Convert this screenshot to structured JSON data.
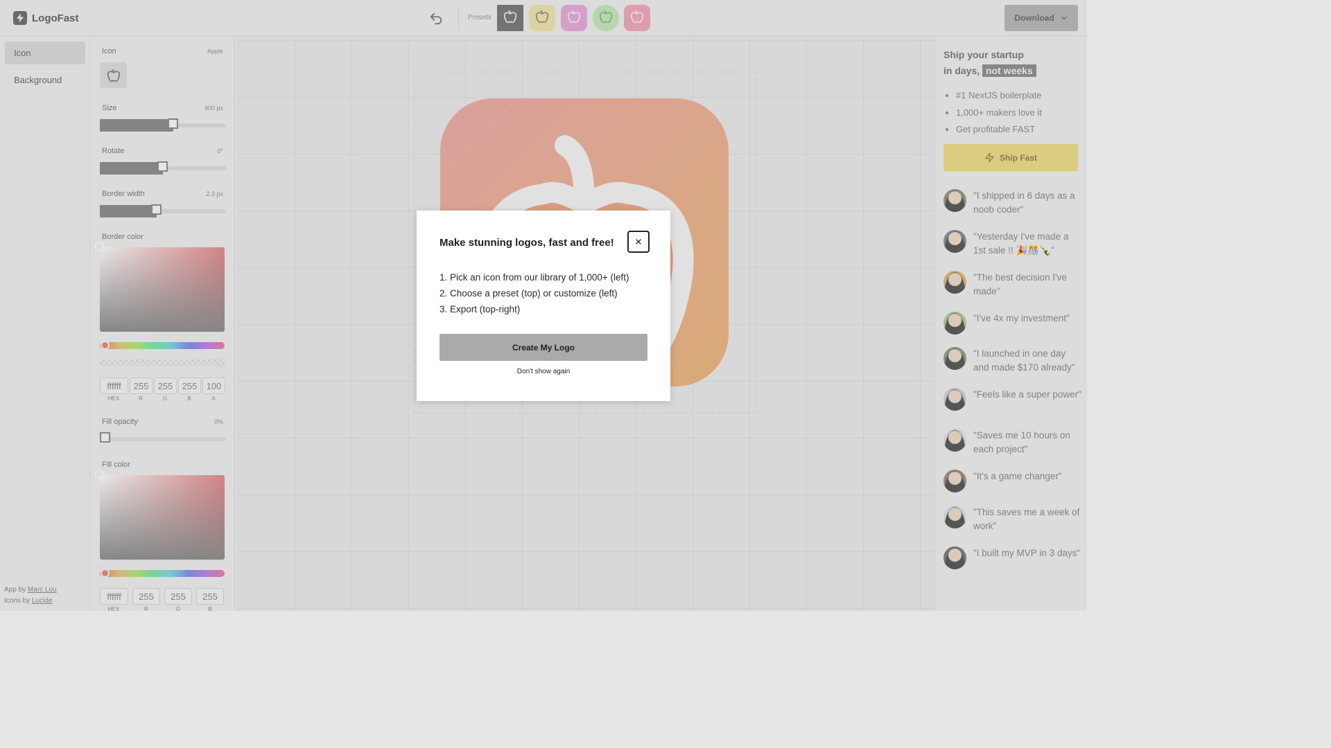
{
  "app": {
    "name": "LogoFast"
  },
  "header": {
    "presets_label": "Presets",
    "download_label": "Download",
    "presets": [
      {
        "name": "preset-dark",
        "bg": "#7a7a7a",
        "fg": "#efefef",
        "shape": "square"
      },
      {
        "name": "preset-yellow",
        "bg": "#e8dfae",
        "fg": "#8d8770",
        "shape": "rounded"
      },
      {
        "name": "preset-pink",
        "bg": "#e0a9d3",
        "fg": "#f2e8f0",
        "shape": "rounded"
      },
      {
        "name": "preset-green",
        "bg": "#bfe3b8",
        "fg": "#8fa98a",
        "shape": "circle"
      },
      {
        "name": "preset-rose",
        "bg": "#e8a6b8",
        "fg": "#f3e6ea",
        "shape": "rounded"
      }
    ]
  },
  "nav": {
    "items": [
      "Icon",
      "Background"
    ],
    "credits": {
      "app_by": "App by",
      "app_author": "Marc Lou",
      "icons_by": "Icons by",
      "icons_author": "Lucide"
    }
  },
  "panel": {
    "icon_label": "Icon",
    "icon_name": "Apple",
    "size": {
      "label": "Size",
      "value": "400 px",
      "level": 0.58
    },
    "rotate": {
      "label": "Rotate",
      "value": "0°",
      "level": 0.5
    },
    "border_width": {
      "label": "Border width",
      "value": "2.3 px",
      "level": 0.45
    },
    "border_color": {
      "label": "Border color",
      "hex": "ffffff",
      "r": "255",
      "g": "255",
      "b": "255",
      "a": "100",
      "caps": {
        "hex": "HEX",
        "r": "R",
        "g": "G",
        "b": "B",
        "a": "A"
      }
    },
    "fill_opacity": {
      "label": "Fill opacity",
      "value": "0%",
      "level": 0.0
    },
    "fill_color": {
      "label": "Fill color",
      "hex": "ffffff",
      "r": "255",
      "g": "255",
      "b": "255",
      "caps": {
        "hex": "HEX",
        "r": "R",
        "g": "G",
        "b": "B"
      }
    }
  },
  "canvas": {
    "logo_gradient": [
      "#e6a9a6",
      "#e6b47e"
    ],
    "icon": "apple-icon"
  },
  "modal": {
    "title": "Make stunning logos, fast and free!",
    "steps": [
      "1. Pick an icon from our library of 1,000+ (left)",
      "2. Choose a preset (top) or customize (left)",
      "3. Export (top-right)"
    ],
    "primary_label": "Create My Logo",
    "secondary_label": "Don't show again"
  },
  "promo": {
    "title_line1": "Ship your startup",
    "title_line2_prefix": "in days,",
    "title_highlight": "not weeks",
    "bullets": [
      "#1 NextJS boilerplate",
      "1,000+ makers love it",
      "Get profitable FAST"
    ],
    "cta_label": "Ship Fast",
    "testimonials": [
      {
        "quote": "\"I shipped in 6 days as a noob coder\"",
        "avatar_color": "#8f9a86"
      },
      {
        "quote": "\"Yesterday I've made a 1st sale !! 🎉🎊🍾\"",
        "avatar_color": "#7f8d99"
      },
      {
        "quote": "\"The best decision I've made\"",
        "avatar_color": "#d9b37a"
      },
      {
        "quote": "\"I've 4x my investment\"",
        "avatar_color": "#a7c79b"
      },
      {
        "quote": "\"I launched in one day and made $170 already\"",
        "avatar_color": "#8a9d8a"
      },
      {
        "quote": "\"Feels like a super power\"",
        "avatar_color": "#c9ccd2"
      },
      {
        "quote": "\"Saves me 10 hours on each project\"",
        "avatar_color": "#d9d7e6"
      },
      {
        "quote": "\"It's a game changer\"",
        "avatar_color": "#9a8f84"
      },
      {
        "quote": "\"This saves me a week of work\"",
        "avatar_color": "#d6dade"
      },
      {
        "quote": "\"I built my MVP in 3 days\"",
        "avatar_color": "#7a7f7a"
      }
    ]
  }
}
